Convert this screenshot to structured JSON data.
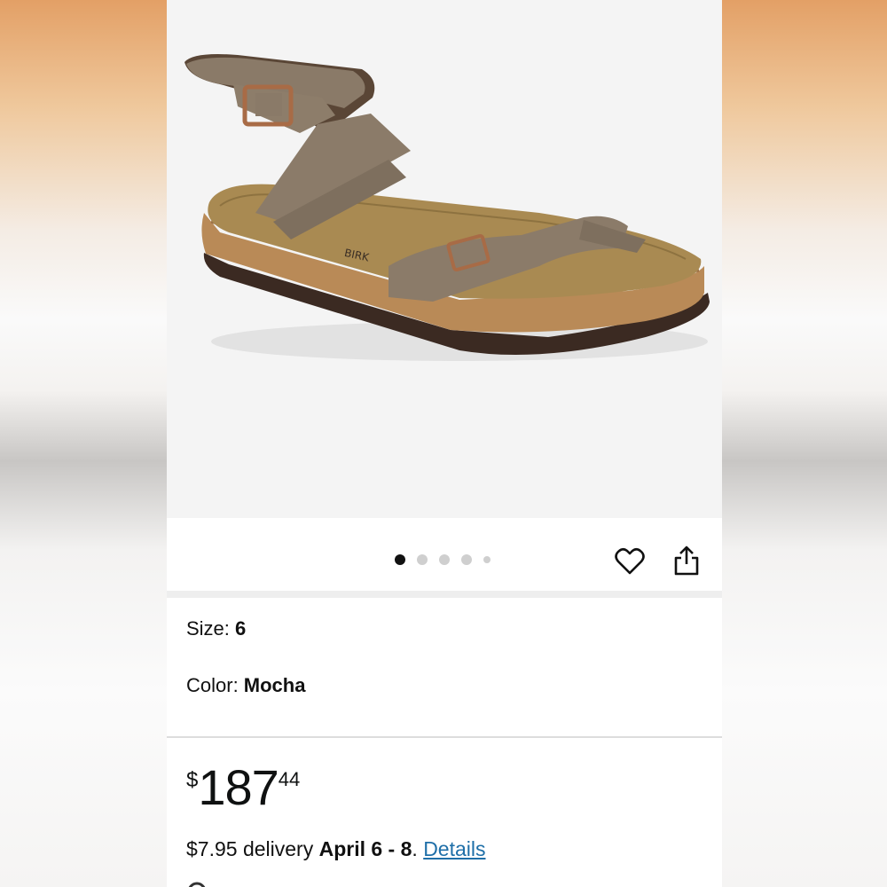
{
  "image": {
    "alt_icon": "sandal-product-image",
    "carousel": {
      "count": 5,
      "active_index": 0
    }
  },
  "actions": {
    "favorite_icon": "heart-icon",
    "share_icon": "share-icon"
  },
  "variants": {
    "size_label": "Size: ",
    "size_value": "6",
    "color_label": "Color: ",
    "color_value": "Mocha"
  },
  "price": {
    "symbol": "$",
    "whole": "187",
    "fraction": "44"
  },
  "delivery": {
    "prefix": "$7.95 delivery ",
    "dates": "April 6 - 8",
    "separator": ". ",
    "details_link": "Details"
  },
  "colors": {
    "link": "#1f6fa8",
    "dot_active": "#111111",
    "dot_inactive": "#cfcfcf"
  }
}
